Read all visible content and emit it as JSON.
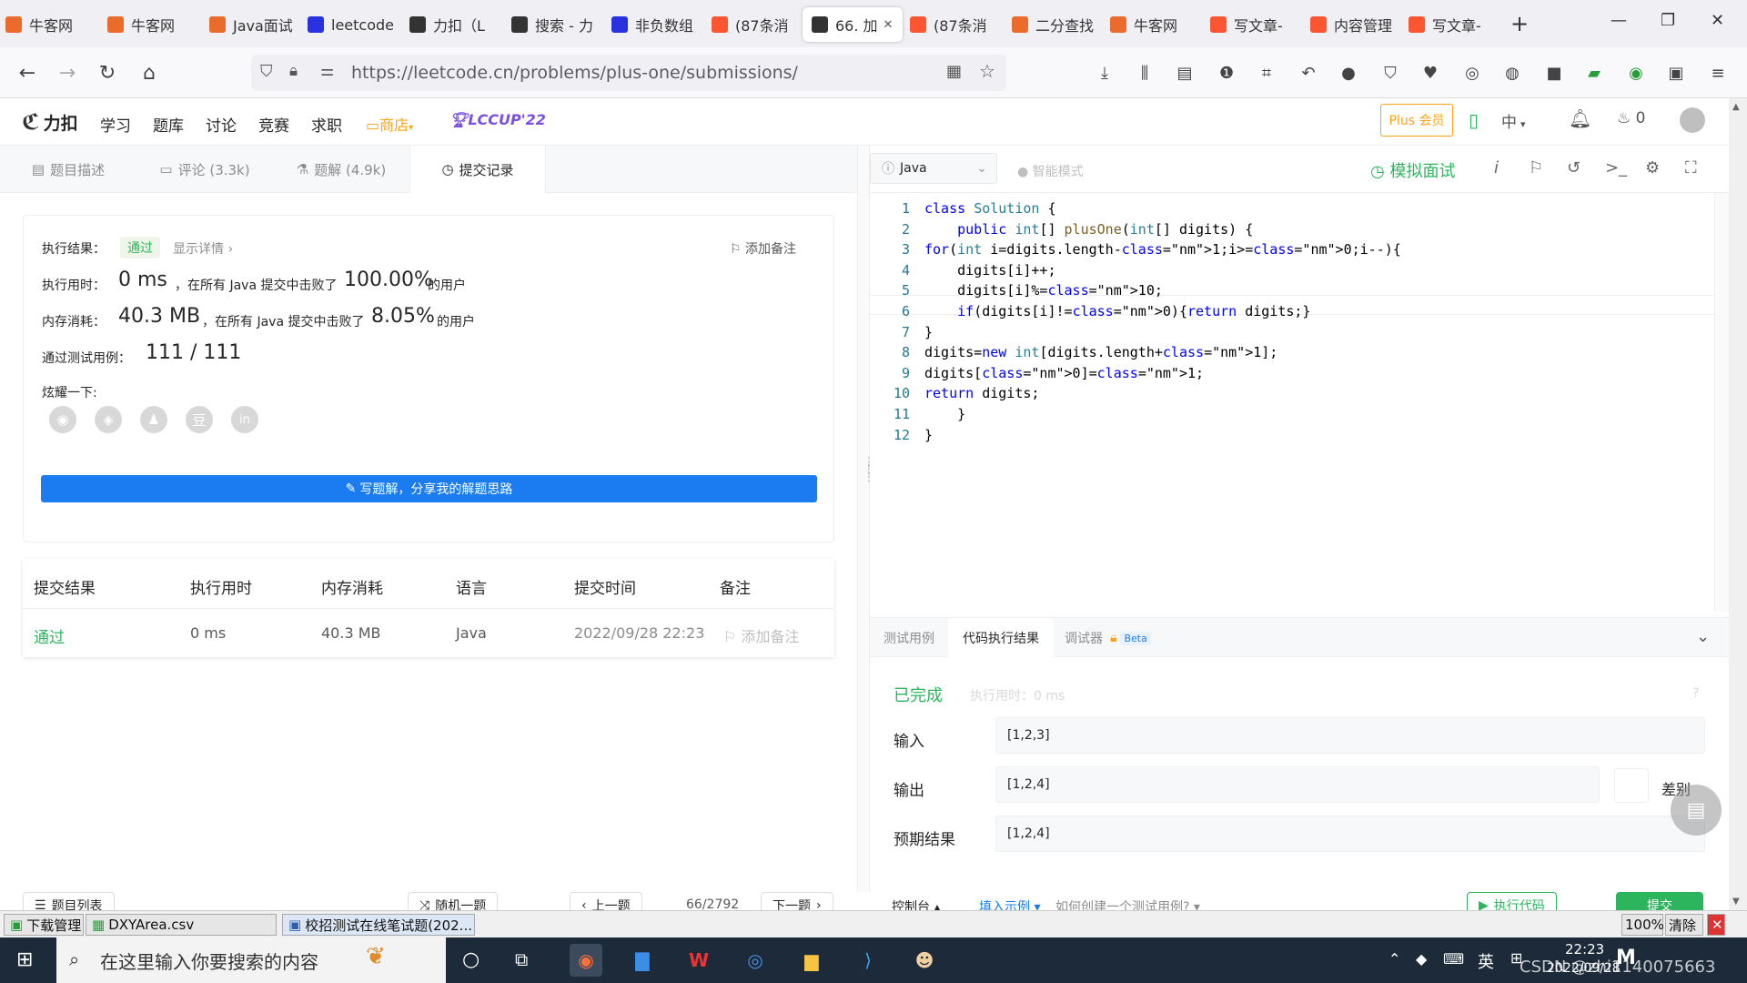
{
  "browser": {
    "tabs": [
      {
        "label": "牛客网",
        "icon": "nowcoder-icon",
        "color": "#eb6b2c"
      },
      {
        "label": "牛客网",
        "icon": "nowcoder-icon",
        "color": "#eb6b2c"
      },
      {
        "label": "Java面试",
        "icon": "nowcoder-icon",
        "color": "#eb6b2c"
      },
      {
        "label": "leetcode",
        "icon": "baidu-paw-icon",
        "color": "#2932e1"
      },
      {
        "label": "力扣（L",
        "icon": "leetcode-icon",
        "color": "#333333"
      },
      {
        "label": "搜索 - 力",
        "icon": "leetcode-icon",
        "color": "#333333"
      },
      {
        "label": "非负数组",
        "icon": "baidu-paw-icon",
        "color": "#2932e1"
      },
      {
        "label": "(87条消",
        "icon": "csdn-icon",
        "color": "#fc5531"
      },
      {
        "label": "66. 加",
        "icon": "leetcode-icon",
        "color": "#333333",
        "active": true
      },
      {
        "label": "(87条消",
        "icon": "csdn-icon",
        "color": "#fc5531"
      },
      {
        "label": "二分查找",
        "icon": "nowcoder-icon",
        "color": "#eb6b2c"
      },
      {
        "label": "牛客网",
        "icon": "nowcoder-icon",
        "color": "#eb6b2c"
      },
      {
        "label": "写文章-",
        "icon": "csdn-icon",
        "color": "#fc5531"
      },
      {
        "label": "内容管理",
        "icon": "csdn-icon",
        "color": "#fc5531"
      },
      {
        "label": "写文章-",
        "icon": "csdn-icon",
        "color": "#fc5531"
      }
    ],
    "new_tab": "+",
    "url": "https://leetcode.cn/problems/plus-one/submissions/",
    "window_controls": {
      "minimize": "—",
      "maximize": "❐",
      "close": "✕"
    }
  },
  "site": {
    "logo_text": "力扣",
    "nav": [
      "学习",
      "题库",
      "讨论",
      "竞赛",
      "求职"
    ],
    "shop": "商店",
    "lccup": "LCCUP'22",
    "plus": "Plus 会员",
    "lang": "中",
    "fire_count": "0"
  },
  "left": {
    "tabs": [
      {
        "label": "题目描述"
      },
      {
        "label": "评论 (3.3k)"
      },
      {
        "label": "题解 (4.9k)"
      },
      {
        "label": "提交记录",
        "active": true
      }
    ],
    "result": {
      "label_result": "执行结果：",
      "status": "通过",
      "show_detail": "显示详情",
      "add_note": "添加备注",
      "label_time": "执行用时：",
      "time_value": "0 ms",
      "time_text": "，在所有 Java 提交中击败了",
      "time_pct": "100.00%",
      "users": "的用户",
      "label_mem": "内存消耗：",
      "mem_value": "40.3 MB",
      "mem_text": "，在所有 Java 提交中击败了",
      "mem_pct": "8.05%",
      "label_cases": "通过测试用例：",
      "cases_value": "111 / 111",
      "label_share": "炫耀一下:",
      "share_icons": [
        "wechat-icon",
        "weibo-icon",
        "qq-icon",
        "douban-icon",
        "linkedin-icon"
      ],
      "write_solution": "写题解，分享我的解题思路"
    },
    "table": {
      "headers": [
        "提交结果",
        "执行用时",
        "内存消耗",
        "语言",
        "提交时间",
        "备注"
      ],
      "rows": [
        {
          "status": "通过",
          "time": "0 ms",
          "memory": "40.3 MB",
          "lang": "Java",
          "submitted": "2022/09/28 22:23",
          "note": "添加备注"
        }
      ]
    },
    "bottom": {
      "problem_list": "题目列表",
      "random": "随机一题",
      "prev": "上一题",
      "page": "66/2792",
      "next": "下一题"
    }
  },
  "right": {
    "language": "Java",
    "smart_mode": "智能模式",
    "mock": "模拟面试",
    "code_lines": [
      "class Solution {",
      "    public int[] plusOne(int[] digits) {",
      "for(int i=digits.length-1;i>=0;i--){",
      "    digits[i]++;",
      "    digits[i]%=10;",
      "    if(digits[i]!=0){return digits;}",
      "}",
      "digits=new int[digits.length+1];",
      "digits[0]=1;",
      "return digits;",
      "    }",
      "}"
    ],
    "console_tabs": [
      "测试用例",
      "代码执行结果",
      "调试器"
    ],
    "beta": "Beta",
    "done": "已完成",
    "exec_time": "执行用时：0 ms",
    "label_input": "输入",
    "input": "[1,2,3]",
    "label_output": "输出",
    "output": "[1,2,4]",
    "label_expected": "预期结果",
    "expected": "[1,2,4]",
    "diff": "差别",
    "console_label": "控制台",
    "fill_example": "填入示例",
    "how_create": "如何创建一个测试用例?",
    "run": "执行代码",
    "submit": "提交"
  },
  "downloads": {
    "manager": "下载管理",
    "file": "DXYArea.csv",
    "page": "校招测试在线笔试题(202...",
    "zoom": "100%",
    "clear": "清除"
  },
  "taskbar": {
    "search_placeholder": "在这里输入你要搜索的内容",
    "ime": "英",
    "time": "22:23",
    "date": "2022/09/28",
    "watermark": "CSDN @zhi1140075663"
  }
}
